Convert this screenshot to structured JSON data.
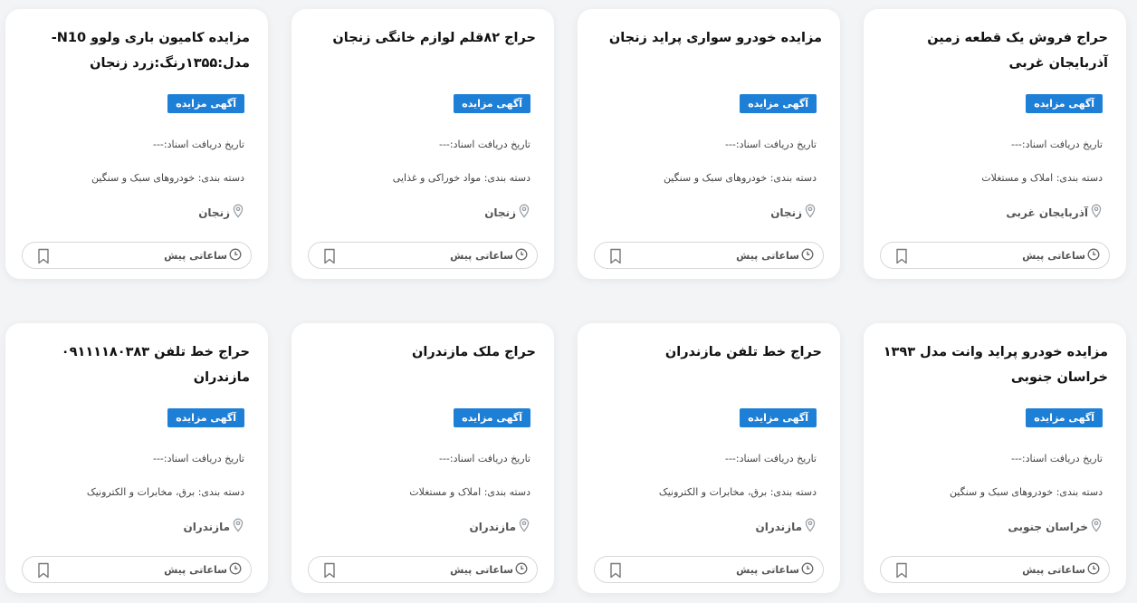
{
  "colors": {
    "accent": "#1e7fd6",
    "card_bg": "#ffffff",
    "page_bg": "#f3f4f6"
  },
  "icons": {
    "location": "map-pin-icon",
    "time": "clock-icon",
    "save": "bookmark-icon"
  },
  "cards": [
    {
      "title": "حراج فروش یک قطعه زمین آذربایجان غربی",
      "badge": "آگهی مزایده",
      "date_text": "تاریخ دریافت اسناد:---",
      "category_text": "دسته بندی: املاک و مستغلات",
      "location": "آذربایجان غربی",
      "time": "ساعاتی پیش"
    },
    {
      "title": "مزایده خودرو سواری پراید زنجان",
      "badge": "آگهی مزایده",
      "date_text": "تاریخ دریافت اسناد:---",
      "category_text": "دسته بندی: خودروهای سبک و سنگین",
      "location": "زنجان",
      "time": "ساعاتی پیش"
    },
    {
      "title": "حراج ۸۲قلم لوازم خانگی زنجان",
      "badge": "آگهی مزایده",
      "date_text": "تاریخ دریافت اسناد:---",
      "category_text": "دسته بندی: مواد خوراکی و غذایی",
      "location": "زنجان",
      "time": "ساعاتی پیش"
    },
    {
      "title": "مزایده کامیون باری ولوو N10-مدل:۱۳۵۵رنگ:زرد زنجان",
      "badge": "آگهی مزایده",
      "date_text": "تاریخ دریافت اسناد:---",
      "category_text": "دسته بندی: خودروهای سبک و سنگین",
      "location": "زنجان",
      "time": "ساعاتی پیش"
    },
    {
      "title": "مزایده خودرو پراید وانت مدل ۱۳۹۳ خراسان جنوبی",
      "badge": "آگهی مزایده",
      "date_text": "تاریخ دریافت اسناد:---",
      "category_text": "دسته بندی: خودروهای سبک و سنگین",
      "location": "خراسان جنوبی",
      "time": "ساعاتی پیش"
    },
    {
      "title": "حراج خط تلفن مازندران",
      "badge": "آگهی مزایده",
      "date_text": "تاریخ دریافت اسناد:---",
      "category_text": "دسته بندی: برق، مخابرات و الکترونیک",
      "location": "مازندران",
      "time": "ساعاتی پیش"
    },
    {
      "title": "حراج ملک مازندران",
      "badge": "آگهی مزایده",
      "date_text": "تاریخ دریافت اسناد:---",
      "category_text": "دسته بندی: املاک و مستغلات",
      "location": "مازندران",
      "time": "ساعاتی پیش"
    },
    {
      "title": "حراج خط تلفن ۰۹۱۱۱۱۸۰۳۸۳ مازندران",
      "badge": "آگهی مزایده",
      "date_text": "تاریخ دریافت اسناد:---",
      "category_text": "دسته بندی: برق، مخابرات و الکترونیک",
      "location": "مازندران",
      "time": "ساعاتی پیش"
    }
  ]
}
